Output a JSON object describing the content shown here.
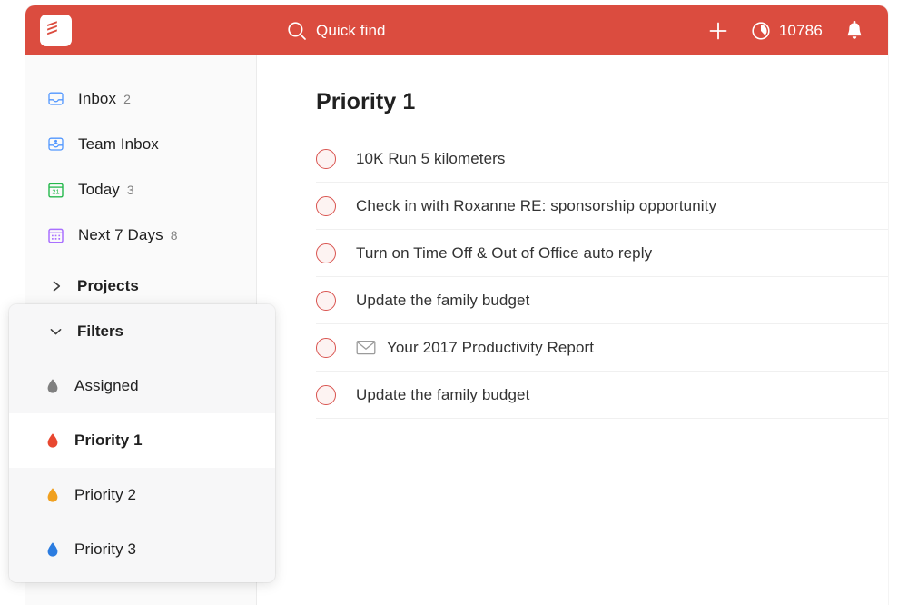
{
  "window": {
    "accent_color": "#db4c3f",
    "sidebar_bg": "#fafafa"
  },
  "header": {
    "logo_name": "todoist-logo",
    "search": {
      "icon": "search-icon",
      "placeholder": "Quick find",
      "value": ""
    },
    "add_label": "+",
    "karma": {
      "icon": "karma-circle-icon",
      "count": "10786"
    },
    "notifications_icon": "bell-icon"
  },
  "sidebar": {
    "items": [
      {
        "label": "Inbox",
        "count": "2",
        "icon": "inbox-icon",
        "color": "#5297ff"
      },
      {
        "label": "Team Inbox",
        "count": "",
        "icon": "team-inbox-icon",
        "color": "#5297ff"
      },
      {
        "label": "Today",
        "count": "3",
        "icon": "calendar-today-icon",
        "color": "#25b84c"
      },
      {
        "label": "Next 7 Days",
        "count": "8",
        "icon": "calendar-week-icon",
        "color": "#a970ff"
      }
    ],
    "projects_section": {
      "label": "Projects",
      "chevron": "chevron-right-icon",
      "expanded": false
    }
  },
  "filters_panel": {
    "title": "Filters",
    "chevron": "chevron-down-icon",
    "expanded": true,
    "items": [
      {
        "label": "Assigned",
        "icon": "droplet-icon",
        "color": "#808080",
        "selected": false
      },
      {
        "label": "Priority 1",
        "icon": "droplet-icon",
        "color": "#e84730",
        "selected": true
      },
      {
        "label": "Priority 2",
        "icon": "droplet-icon",
        "color": "#f0a020",
        "selected": false
      },
      {
        "label": "Priority 3",
        "icon": "droplet-icon",
        "color": "#2b7ce0",
        "selected": false
      }
    ]
  },
  "main": {
    "title": "Priority 1",
    "tasks": [
      {
        "text": "10K Run 5 kilometers",
        "checkbox": "task-checkbox-p1",
        "leading_icon": ""
      },
      {
        "text": "Check in with Roxanne RE: sponsorship opportunity",
        "checkbox": "task-checkbox-p1",
        "leading_icon": ""
      },
      {
        "text": "Turn on Time Off & Out of Office auto reply",
        "checkbox": "task-checkbox-p1",
        "leading_icon": ""
      },
      {
        "text": "Update the family budget",
        "checkbox": "task-checkbox-p1",
        "leading_icon": ""
      },
      {
        "text": "Your 2017 Productivity Report",
        "checkbox": "task-checkbox-p1",
        "leading_icon": "envelope-icon"
      },
      {
        "text": "Update the family budget",
        "checkbox": "task-checkbox-p1",
        "leading_icon": ""
      }
    ]
  }
}
